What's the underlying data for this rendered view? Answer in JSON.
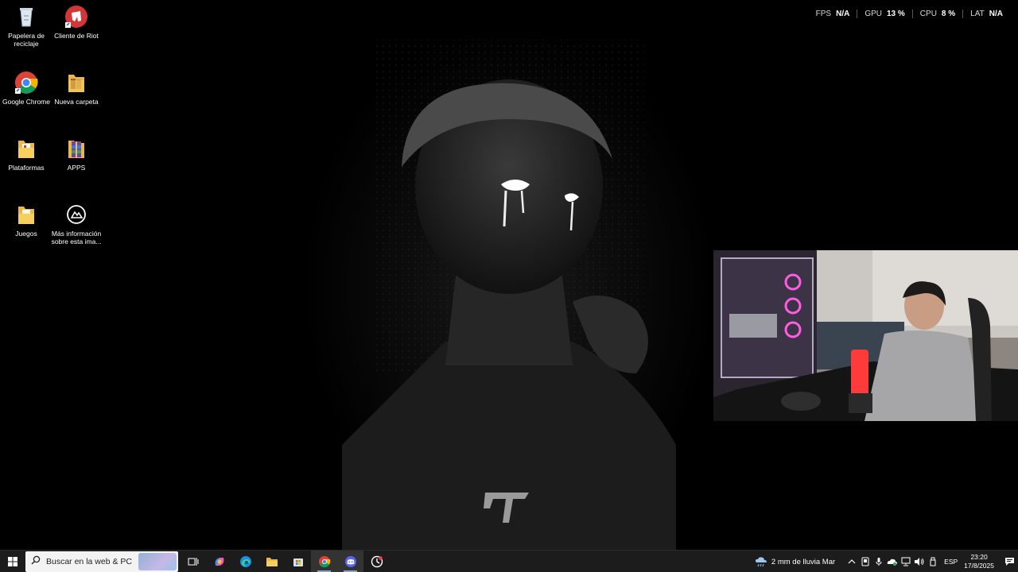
{
  "desktop": {
    "icons": [
      {
        "label": "Papelera de reciclaje",
        "icon": "recycle-bin-icon"
      },
      {
        "label": "Cliente de Riot",
        "icon": "riot-client-icon"
      },
      {
        "label": "Google Chrome",
        "icon": "chrome-icon"
      },
      {
        "label": "Nueva carpeta",
        "icon": "folder-icon"
      },
      {
        "label": "Plataformas",
        "icon": "folder-icon"
      },
      {
        "label": "APPS",
        "icon": "winrar-archive-icon"
      },
      {
        "label": "Juegos",
        "icon": "folder-icon"
      },
      {
        "label": "Más información sobre esta ima...",
        "icon": "info-camera-icon"
      }
    ]
  },
  "hud": {
    "fps_label": "FPS",
    "fps_value": "N/A",
    "gpu_label": "GPU",
    "gpu_value": "13 %",
    "cpu_label": "CPU",
    "cpu_value": "8 %",
    "lat_label": "LAT",
    "lat_value": "N/A"
  },
  "taskbar": {
    "search_placeholder": "Buscar en la web & PC",
    "apps": [
      "task-view-icon",
      "copilot-icon",
      "edge-icon",
      "file-explorer-icon",
      "store-icon",
      "chrome-icon",
      "discord-icon",
      "clock-app-icon"
    ],
    "weather": "2 mm de lluvia Mar",
    "language": "ESP",
    "time": "23:20",
    "date": "17/8/2025"
  },
  "colors": {
    "taskbar_bg": "#1c1c1c",
    "accent": "#7aa7d8",
    "riot_red": "#d13639"
  }
}
